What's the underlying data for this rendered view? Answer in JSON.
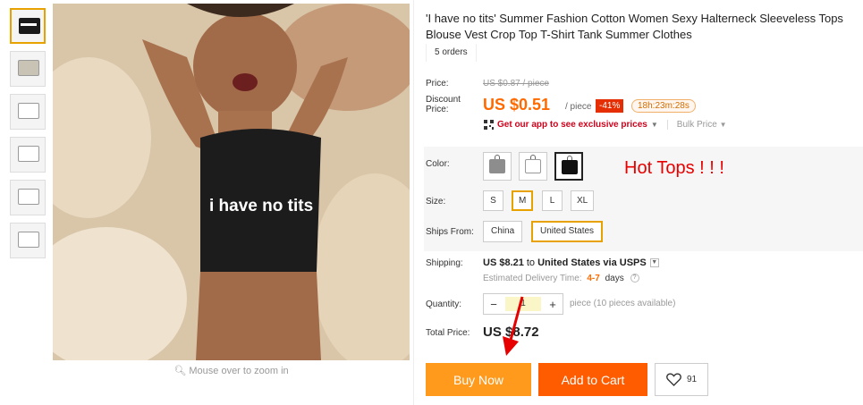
{
  "product": {
    "title": "'I have no tits' Summer Fashion Cotton Women Sexy Halterneck Sleeveless Tops Blouse Vest Crop Top T-Shirt Tank Summer Clothes",
    "orders": "5 orders",
    "image_text": "i have no tits",
    "zoom_hint": "Mouse over to zoom in"
  },
  "thumbnails": [
    {
      "color": "#1a1a1a"
    },
    {
      "color": "#c9c3b6"
    },
    {
      "color": "#ffffff"
    },
    {
      "color": "#ffffff"
    },
    {
      "color": "#ffffff"
    },
    {
      "color": "#ffffff"
    }
  ],
  "price": {
    "label": "Price:",
    "original": "US $0.87 / piece",
    "discount_label": "Discount Price:",
    "discount": "US $0.51",
    "per": "/ piece",
    "percent_off": "-41%",
    "countdown": "18h:23m:28s",
    "app_promo": "Get our app to see exclusive prices",
    "bulk": "Bulk Price"
  },
  "color": {
    "label": "Color:",
    "swatches": [
      {
        "color": "#8d8d8d"
      },
      {
        "color": "#ffffff"
      },
      {
        "color": "#111111"
      }
    ],
    "annotation": "Hot Tops ! ! !"
  },
  "size": {
    "label": "Size:",
    "options": [
      "S",
      "M",
      "L",
      "XL"
    ],
    "selected": "M"
  },
  "ships_from": {
    "label": "Ships From:",
    "options": [
      "China",
      "United States"
    ],
    "selected": "United States"
  },
  "shipping": {
    "label": "Shipping:",
    "cost": "US $8.21",
    "to": "to",
    "destination": "United States via USPS",
    "delivery_label": "Estimated Delivery Time:",
    "delivery_days": "4-7",
    "delivery_unit": "days"
  },
  "quantity": {
    "label": "Quantity:",
    "minus": "−",
    "plus": "+",
    "value": "1",
    "note": "piece (10 pieces available)"
  },
  "total": {
    "label": "Total Price:",
    "value": "US $8.72"
  },
  "actions": {
    "buy_now": "Buy Now",
    "add_to_cart": "Add to Cart",
    "wishlist_count": "91"
  },
  "colors": {
    "accent": "#ff6a00",
    "buy_now": "#ff9a1c",
    "add_cart": "#ff5c00",
    "selected_border": "#e8a200",
    "annotation": "#e60000"
  }
}
